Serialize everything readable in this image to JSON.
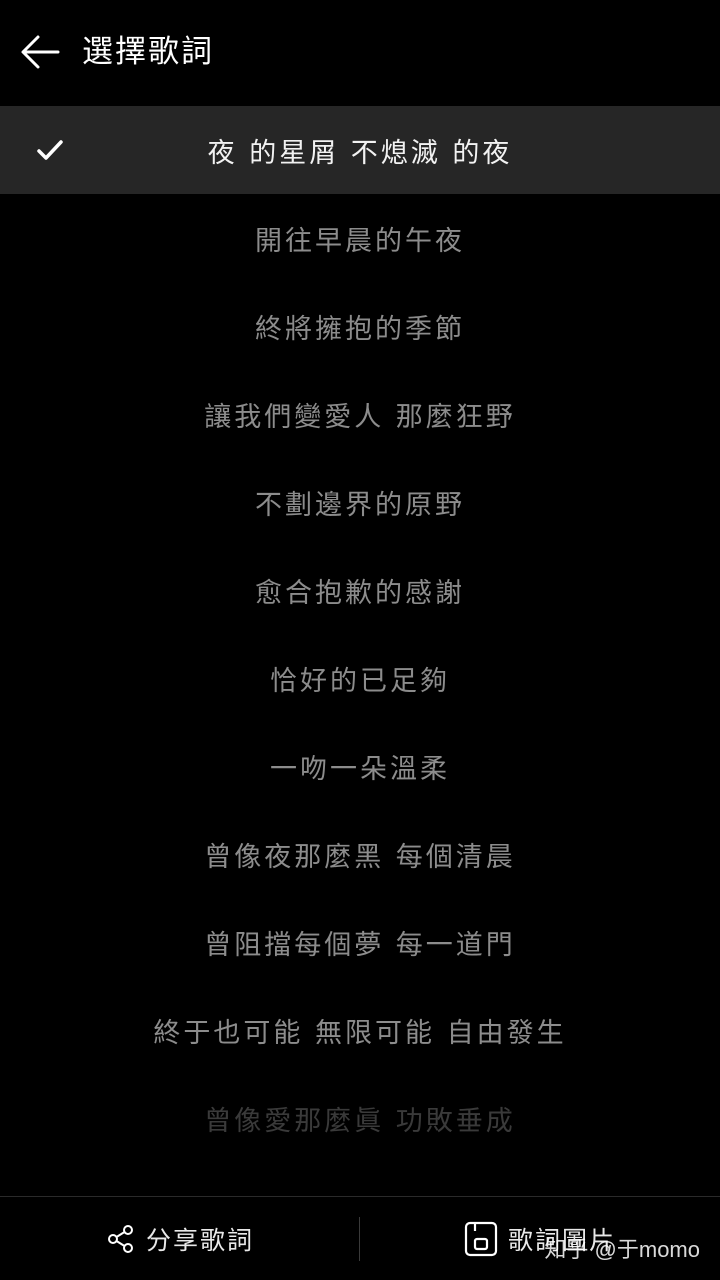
{
  "header": {
    "title": "選擇歌詞"
  },
  "lyrics": [
    {
      "text": "夜 的星屑 不熄滅 的夜",
      "selected": true
    },
    {
      "text": "開往早晨的午夜"
    },
    {
      "text": "終將擁抱的季節"
    },
    {
      "text": "讓我們變愛人 那麼狂野"
    },
    {
      "text": "不劃邊界的原野"
    },
    {
      "text": "愈合抱歉的感謝"
    },
    {
      "text": "恰好的已足夠"
    },
    {
      "text": "一吻一朵溫柔"
    },
    {
      "text": "曾像夜那麼黑 每個清晨"
    },
    {
      "text": "曾阻擋每個夢 每一道門"
    },
    {
      "text": "終于也可能 無限可能 自由發生"
    },
    {
      "text": "曾像愛那麼眞 功敗垂成",
      "faded": true
    }
  ],
  "bottom_bar": {
    "share_label": "分享歌詞",
    "image_label": "歌詞圖片"
  },
  "watermark": "知乎 @于momo",
  "colors": {
    "background": "#000000",
    "selected_row": "#262626",
    "lyric_text": "#8c8c8c",
    "selected_text": "#f2f2f2"
  }
}
